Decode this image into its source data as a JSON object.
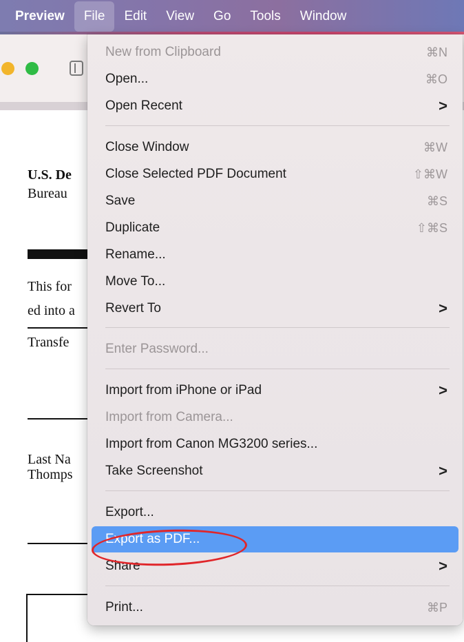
{
  "menubar": {
    "items": [
      "Preview",
      "File",
      "Edit",
      "View",
      "Go",
      "Tools",
      "Window"
    ]
  },
  "document": {
    "lines": [
      "U.S. De",
      "Bureau",
      "This for",
      "ed into a",
      "Transfe",
      "Last Na",
      "Thomps"
    ]
  },
  "file_menu": {
    "items": [
      {
        "label": "New from Clipboard",
        "shortcut": "⌘N"
      },
      {
        "label": "Open...",
        "shortcut": "⌘O"
      },
      {
        "label": "Open Recent",
        "shortcut": ">"
      },
      {
        "label": "Close Window",
        "shortcut": "⌘W"
      },
      {
        "label": "Close Selected PDF Document",
        "shortcut": "⇧⌘W"
      },
      {
        "label": "Save",
        "shortcut": "⌘S"
      },
      {
        "label": "Duplicate",
        "shortcut": "⇧⌘S"
      },
      {
        "label": "Rename..."
      },
      {
        "label": "Move To..."
      },
      {
        "label": "Revert To",
        "shortcut": ">"
      },
      {
        "label": "Enter Password..."
      },
      {
        "label": "Import from iPhone or iPad",
        "shortcut": ">"
      },
      {
        "label": "Import from Camera..."
      },
      {
        "label": "Import from Canon MG3200 series..."
      },
      {
        "label": "Take Screenshot",
        "shortcut": ">"
      },
      {
        "label": "Export..."
      },
      {
        "label": "Export as PDF..."
      },
      {
        "label": "Share",
        "shortcut": ">"
      },
      {
        "label": "Print...",
        "shortcut": "⌘P"
      }
    ]
  },
  "colors": {
    "highlight": "#5b9cf4",
    "annotation": "#e0262a",
    "traffic_yellow": "#f2b52b",
    "traffic_green": "#2fbb45"
  }
}
